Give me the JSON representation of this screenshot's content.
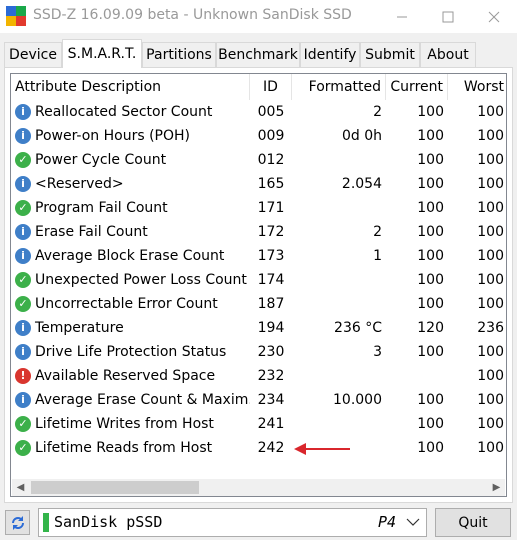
{
  "window": {
    "title": "SSD-Z 16.09.09 beta - Unknown SanDisk SSD"
  },
  "tabs": [
    {
      "label": "Device",
      "active": false
    },
    {
      "label": "S.M.A.R.T.",
      "active": true
    },
    {
      "label": "Partitions",
      "active": false
    },
    {
      "label": "Benchmark",
      "active": false
    },
    {
      "label": "Identify",
      "active": false
    },
    {
      "label": "Submit",
      "active": false
    },
    {
      "label": "About",
      "active": false
    }
  ],
  "table": {
    "columns": [
      "Attribute Description",
      "ID",
      "Formatted",
      "Current",
      "Worst"
    ],
    "rows": [
      {
        "status": "info",
        "desc": "Reallocated Sector Count",
        "id": "005",
        "formatted": "2",
        "current": "100",
        "worst": "100"
      },
      {
        "status": "info",
        "desc": "Power-on Hours (POH)",
        "id": "009",
        "formatted": "0d 0h",
        "current": "100",
        "worst": "100"
      },
      {
        "status": "ok",
        "desc": "Power Cycle Count",
        "id": "012",
        "formatted": "",
        "current": "100",
        "worst": "100"
      },
      {
        "status": "info",
        "desc": "<Reserved>",
        "id": "165",
        "formatted": "2.054",
        "current": "100",
        "worst": "100"
      },
      {
        "status": "ok",
        "desc": "Program Fail Count",
        "id": "171",
        "formatted": "",
        "current": "100",
        "worst": "100"
      },
      {
        "status": "info",
        "desc": "Erase Fail Count",
        "id": "172",
        "formatted": "2",
        "current": "100",
        "worst": "100"
      },
      {
        "status": "info",
        "desc": "Average Block Erase Count",
        "id": "173",
        "formatted": "1",
        "current": "100",
        "worst": "100"
      },
      {
        "status": "ok",
        "desc": "Unexpected Power Loss Count",
        "id": "174",
        "formatted": "",
        "current": "100",
        "worst": "100"
      },
      {
        "status": "ok",
        "desc": "Uncorrectable Error Count",
        "id": "187",
        "formatted": "",
        "current": "100",
        "worst": "100"
      },
      {
        "status": "info",
        "desc": "Temperature",
        "id": "194",
        "formatted": "236 °C",
        "current": "120",
        "worst": "236"
      },
      {
        "status": "info",
        "desc": "Drive Life Protection Status",
        "id": "230",
        "formatted": "3",
        "current": "100",
        "worst": "100"
      },
      {
        "status": "bad",
        "desc": "Available Reserved Space",
        "id": "232",
        "formatted": "",
        "current": "",
        "worst": "100"
      },
      {
        "status": "info",
        "desc": "Average Erase Count & Maxim...",
        "id": "234",
        "formatted": "10.000",
        "current": "100",
        "worst": "100"
      },
      {
        "status": "ok",
        "desc": "Lifetime Writes from Host",
        "id": "241",
        "formatted": "",
        "current": "100",
        "worst": "100"
      },
      {
        "status": "ok",
        "desc": "Lifetime Reads from Host",
        "id": "242",
        "formatted": "",
        "current": "100",
        "worst": "100"
      }
    ]
  },
  "drive": {
    "name": "SanDisk pSSD",
    "tag": "P4"
  },
  "buttons": {
    "quit": "Quit"
  },
  "colors": {
    "info": "#3f7fc8",
    "ok": "#3cb04a",
    "bad": "#d9362f",
    "arrow": "#d9262c"
  }
}
